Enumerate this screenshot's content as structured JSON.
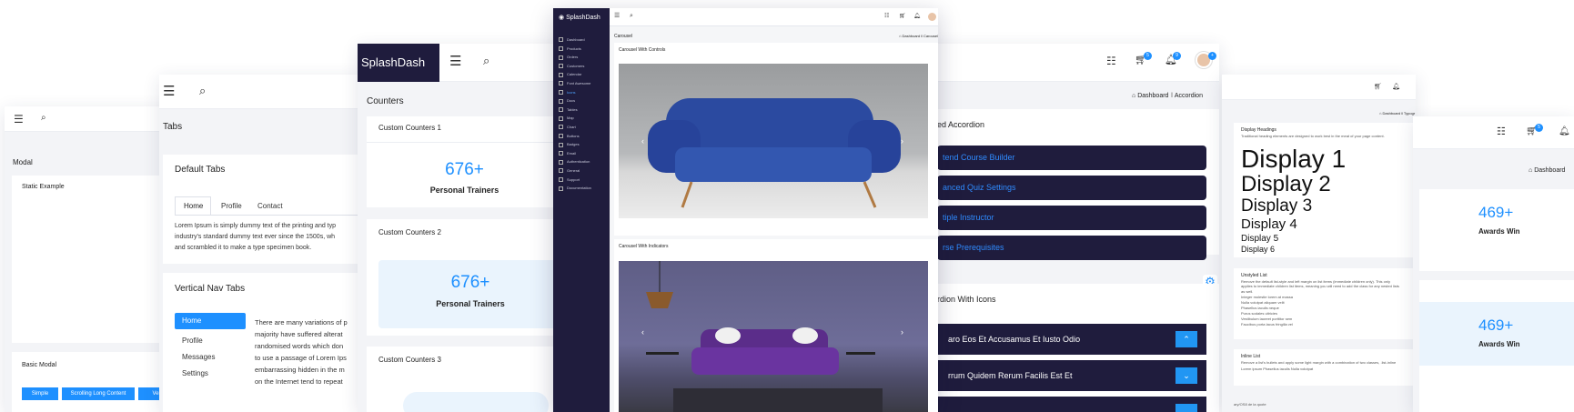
{
  "brand": "SplashDash",
  "modal": {
    "header": "Modal",
    "static_title": "Static Example",
    "basic_title": "Basic Modal",
    "buttons": [
      "Simple",
      "Scrolling Long Content",
      "Ver"
    ]
  },
  "tabs": {
    "header": "Tabs",
    "default_title": "Default Tabs",
    "tab_labels": [
      "Home",
      "Profile",
      "Contact"
    ],
    "tab_text_lines": [
      "Lorem Ipsum is simply dummy text of the printing and typ",
      "industry's standard dummy text ever since the 1500s, wh",
      "and scrambled it to make a type specimen book."
    ],
    "vertical_title": "Vertical Nav Tabs",
    "vertical_items": [
      "Home",
      "Profile",
      "Messages",
      "Settings"
    ],
    "vertical_text_lines": [
      "There are many variations of p",
      "majority have suffered alterat",
      "randomised words which don",
      "to use a passage of Lorem Ips",
      "embarrassing hidden in the m",
      "on the Internet tend to repeat"
    ]
  },
  "counters": {
    "header": "Counters",
    "c1": {
      "title": "Custom Counters 1",
      "value": "676+",
      "label": "Personal Trainers"
    },
    "c2": {
      "title": "Custom Counters 2",
      "value": "676+",
      "label": "Personal Trainers"
    },
    "c3": {
      "title": "Custom Counters 3"
    }
  },
  "carousel": {
    "header": "Carousel",
    "breadcrumb_home": "Dashboard",
    "breadcrumb_current": "Carousel",
    "card1_title": "Carousel With Controls",
    "card2_title": "Carousel With Indicators"
  },
  "sidebar": {
    "items": [
      "Dashboard",
      "Products",
      "Orders",
      "Customers",
      "Calendar",
      "Font Awesome",
      "Icons",
      "Docs",
      "Tables",
      "Map",
      "Chart",
      "Buttons",
      "Badges",
      "Email",
      "Authentication",
      "General",
      "Support",
      "Documentation"
    ]
  },
  "accordion": {
    "breadcrumb_home": "Dashboard",
    "breadcrumb_current": "Accordion",
    "title1": "ed Accordion",
    "items1": [
      "tend Course Builder",
      "anced Quiz Settings",
      "tiple Instructor",
      "rse Prerequisites"
    ],
    "title2": "rdion With Icons",
    "items2": [
      "aro Eos Et Accusamus Et Iusto Odio",
      "rrum Quidem Rerum Facilis Est Et"
    ]
  },
  "typography": {
    "breadcrumb_home": "Dashboard",
    "breadcrumb_current": "Typogr",
    "heading_title": "Display Headings",
    "heading_desc": "Traditional heading elements are designed to work best in the meat of your page content.",
    "displays": [
      "Display 1",
      "Display 2",
      "Display 3",
      "Display 4",
      "Display 5",
      "Display 6"
    ],
    "unstyled_title": "Unstyled List",
    "unstyled_desc_lines": [
      "Remove the default list-style and left margin on list items (immediate children only). This only",
      "applies to immediate children list items, meaning you will need to add the class for any nested lists"
    ],
    "unstyled_list": [
      "as well.",
      "Integer molestie lorem at massa",
      "Nulla volutpat aliquam velit",
      "Phasellus iaculis neque",
      "Purus sodales ultricies",
      "Vestibulum laoreet porttitor sem",
      "Faucibus porta lacus fringilla vel"
    ],
    "inline_title": "Inline List",
    "inline_desc": "Remove a list's bullets and apply some light margin with a combination of two classes, .list-inline",
    "inline_items": "Lorem ipsum   Phasellus iaculis   Nulla volutpat",
    "quote": "ary/OS8 de la quote"
  },
  "awards": {
    "breadcrumb_home": "Dashboard",
    "v1": "469+",
    "l1": "Awards Win",
    "v2": "469+",
    "l2": "Awards Win"
  },
  "badges": {
    "cart": "5",
    "bell": "9",
    "plus": "+"
  }
}
